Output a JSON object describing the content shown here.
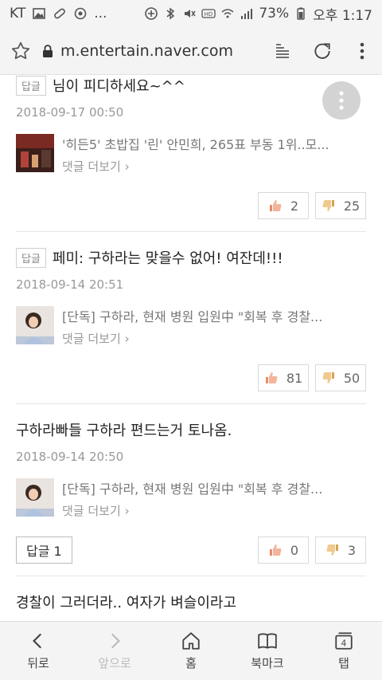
{
  "status": {
    "carrier": "KT",
    "more": "...",
    "battery": "73%",
    "time": "오후 1:17"
  },
  "urlbar": {
    "url": "m.entertain.naver.com"
  },
  "comments": [
    {
      "reply_tag": "답글",
      "text": "님이 피디하세요~^^",
      "date": "2018-09-17 00:50",
      "article_title": "'히든5' 초밥집 '린' 안민희, 265표 부동 1위..모...",
      "more_comments": "댓글 더보기",
      "likes": "2",
      "dislikes": "25"
    },
    {
      "reply_tag": "답글",
      "text": "페미: 구하라는 맞을수 없어! 여잔데!!!",
      "date": "2018-09-14 20:51",
      "article_title": "[단독] 구하라, 현재 병원 입원中 \"회복 후 경찰...",
      "more_comments": "댓글 더보기",
      "likes": "81",
      "dislikes": "50"
    },
    {
      "text": "구하라빠들 구하라 편드는거 토나옴.",
      "date": "2018-09-14 20:50",
      "article_title": "[단독] 구하라, 현재 병원 입원中 \"회복 후 경찰...",
      "more_comments": "댓글 더보기",
      "reply_button": "답글 1",
      "likes": "0",
      "dislikes": "3"
    },
    {
      "text": "경찰이 그러더라.. 여자가 벼슬이라고"
    }
  ],
  "nav": {
    "back": "뒤로",
    "forward": "앞으로",
    "home": "홈",
    "bookmarks": "북마크",
    "tabs": "탭",
    "tab_count": "4"
  }
}
